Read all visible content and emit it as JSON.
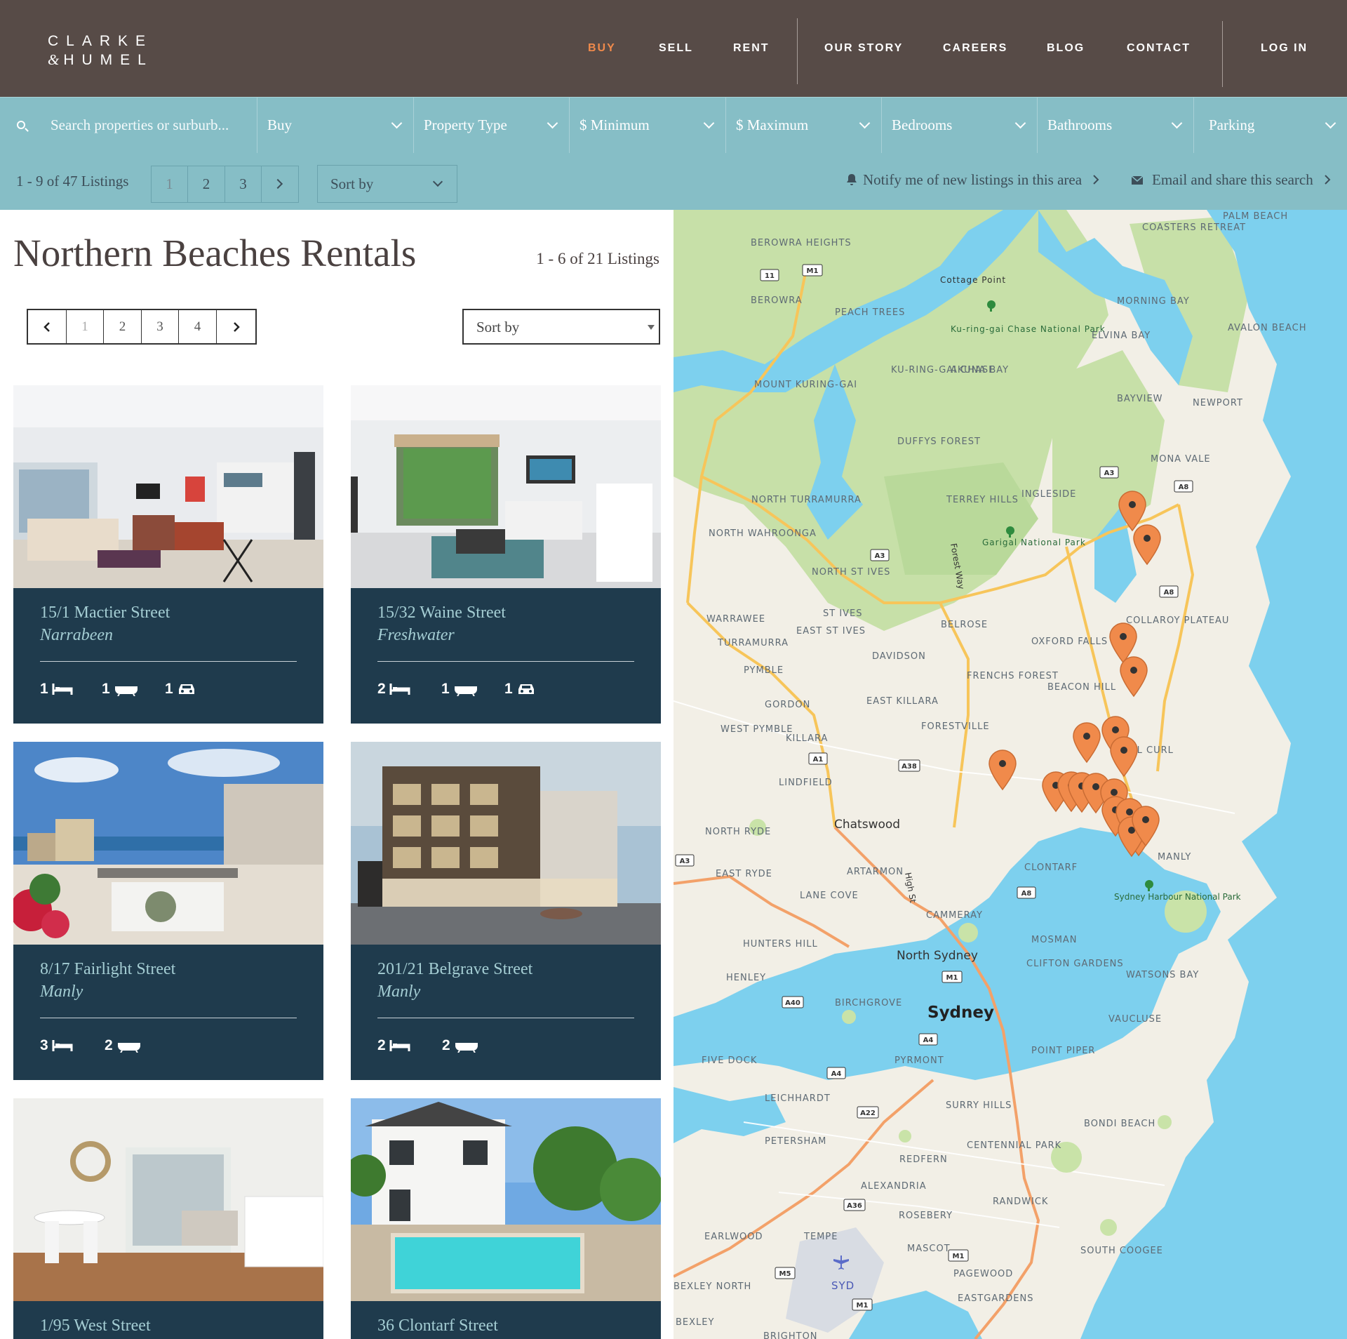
{
  "brand": {
    "line1": "CLARKE",
    "line2_amp": "&",
    "line2": "HUMEL"
  },
  "nav": {
    "items": [
      {
        "label": "BUY",
        "active": true
      },
      {
        "label": "SELL"
      },
      {
        "label": "RENT"
      },
      {
        "label": "OUR STORY"
      },
      {
        "label": "CAREERS"
      },
      {
        "label": "BLOG"
      },
      {
        "label": "CONTACT"
      }
    ],
    "login": "LOG IN"
  },
  "filters": {
    "search_placeholder": "Search properties or surburb...",
    "type": "Buy",
    "property_type": "Property Type",
    "min": "$ Minimum",
    "max": "$ Maximum",
    "bedrooms": "Bedrooms",
    "bathrooms": "Bathrooms",
    "parking": "Parking"
  },
  "toolbar": {
    "count": "1 - 9 of 47 Listings",
    "pages": [
      "1",
      "2",
      "3"
    ],
    "sort": "Sort by",
    "notify": "Notify me of new listings in this area",
    "email": "Email and share this search"
  },
  "listing": {
    "title": "Northern Beaches Rentals",
    "count": "1 - 6 of 21 Listings",
    "pages": [
      "1",
      "2",
      "3",
      "4"
    ],
    "sort": "Sort by"
  },
  "cards": [
    {
      "street": "15/1 Mactier Street",
      "suburb": "Narrabeen",
      "beds": "1",
      "baths": "1",
      "cars": "1"
    },
    {
      "street": "15/32 Waine Street",
      "suburb": "Freshwater",
      "beds": "2",
      "baths": "1",
      "cars": "1"
    },
    {
      "street": "8/17 Fairlight Street",
      "suburb": "Manly",
      "beds": "3",
      "baths": "2"
    },
    {
      "street": "201/21 Belgrave Street",
      "suburb": "Manly",
      "beds": "2",
      "baths": "2"
    },
    {
      "street": "1/95 West Street",
      "suburb": ""
    },
    {
      "street": "36 Clontarf Street",
      "suburb": ""
    }
  ],
  "map": {
    "place_labels": [
      "BEROWRA HEIGHTS",
      "BEROWRA",
      "Cottage Point",
      "Ku-ring-gai Chase National Park",
      "COASTERS RETREAT",
      "PALM BEACH",
      "MORNING BAY",
      "AVALON BEACH",
      "ELVINA BAY",
      "PEACH TREES",
      "AKUNA BAY",
      "KU-RING-GAI CHASE",
      "MOUNT KURING-GAI",
      "BAYVIEW",
      "NEWPORT",
      "DUFFYS FOREST",
      "MONA VALE",
      "INGLESIDE",
      "TERREY HILLS",
      "NORTH TURRAMURRA",
      "Garigal National Park",
      "NORTH WAHROONGA",
      "NORTH ST IVES",
      "ST IVES",
      "EAST ST IVES",
      "BELROSE",
      "COLLAROY PLATEAU",
      "OXFORD FALLS",
      "WARRAWEE",
      "TURRAMURRA",
      "DAVIDSON",
      "PYMBLE",
      "FRENCHS FOREST",
      "BEACON HILL",
      "GORDON",
      "EAST KILLARA",
      "WEST PYMBLE",
      "KILLARA",
      "FORESTVILLE",
      "CURL CURL",
      "LINDFIELD",
      "Chatswood",
      "NORTH RYDE",
      "EAST RYDE",
      "ARTARMON",
      "LANE COVE",
      "CLONTARF",
      "MANLY",
      "Sydney Harbour National Park",
      "CAMMERAY",
      "MOSMAN",
      "HUNTERS HILL",
      "North Sydney",
      "CLIFTON GARDENS",
      "WATSONS BAY",
      "HENLEY",
      "BIRCHGROVE",
      "Sydney",
      "VAUCLUSE",
      "FIVE DOCK",
      "PYRMONT",
      "POINT PIPER",
      "LEICHHARDT",
      "SURRY HILLS",
      "BONDI BEACH",
      "PETERSHAM",
      "REDFERN",
      "CENTENNIAL PARK",
      "ALEXANDRIA",
      "RANDWICK",
      "ROSEBERY",
      "EARLWOOD",
      "TEMPE",
      "MASCOT",
      "SOUTH COOGEE",
      "PAGEWOOD",
      "SYD",
      "BEXLEY NORTH",
      "EASTGARDENS",
      "BEXLEY",
      "BRIGHTON",
      "High St",
      "Forest Way"
    ],
    "road_shields": [
      "M1",
      "11",
      "A3",
      "A8",
      "A38",
      "A1",
      "A40",
      "A4",
      "A22",
      "A36",
      "M5"
    ]
  },
  "colors": {
    "header": "#574b47",
    "filter_bar": "#86bec6",
    "card": "#1f3b4d",
    "accent": "#f08a4b",
    "water": "#7dd0ee"
  }
}
